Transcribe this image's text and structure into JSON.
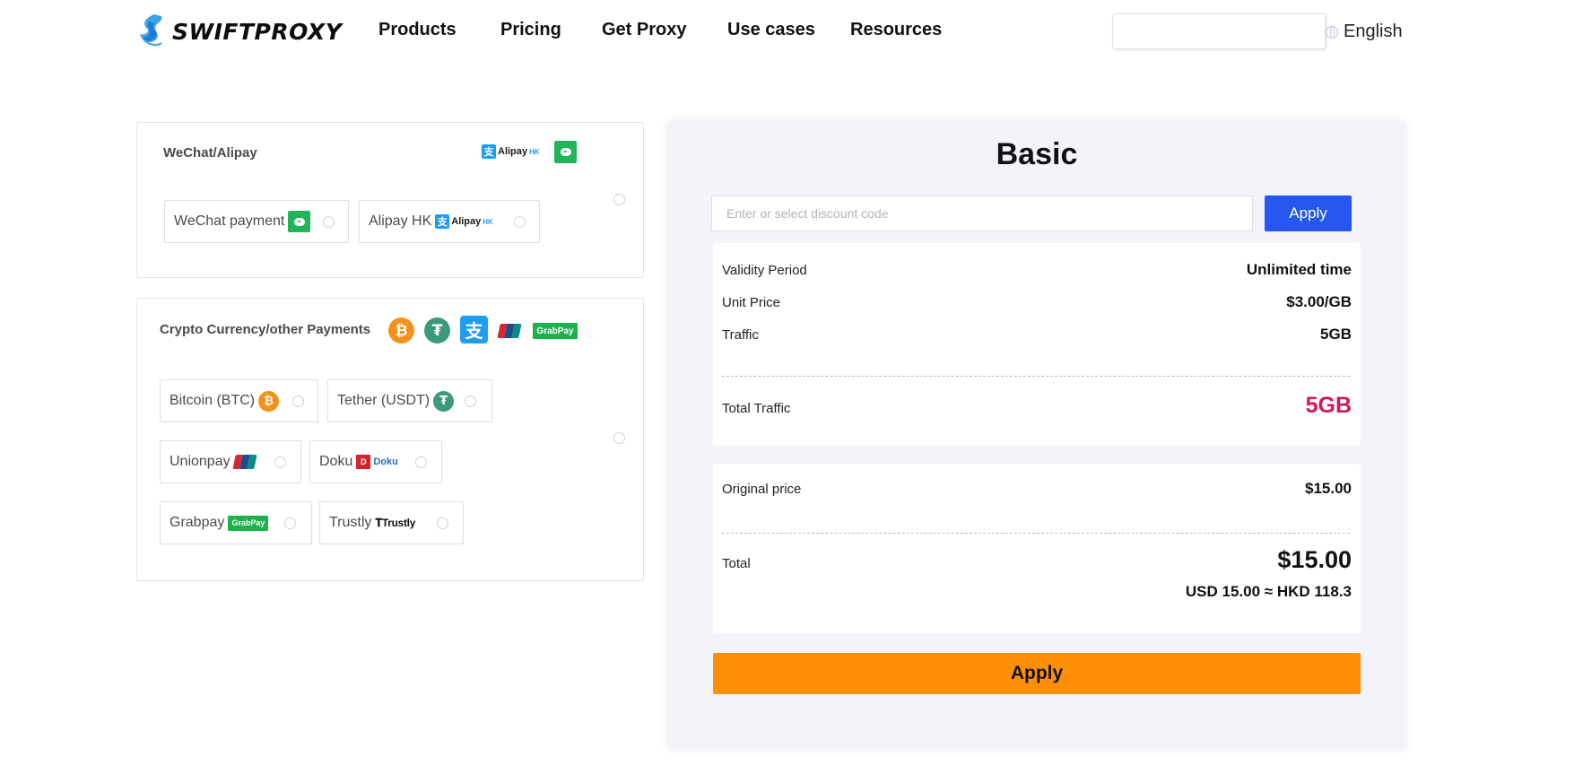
{
  "header": {
    "logo_text": "SWIFTPROXY",
    "nav": [
      "Products",
      "Pricing",
      "Get Proxy",
      "Use cases",
      "Resources"
    ],
    "language": "English",
    "search_value": ""
  },
  "payments": {
    "wechat_alipay": {
      "title": "WeChat/Alipay",
      "options": [
        {
          "label": "WeChat payment",
          "icon": "wechat-icon"
        },
        {
          "label": "Alipay HK",
          "icon": "alipay-hk-icon"
        }
      ]
    },
    "crypto": {
      "title": "Crypto Currency/other Payments",
      "options": [
        {
          "label": "Bitcoin (BTC)",
          "icon": "bitcoin-icon"
        },
        {
          "label": "Tether (USDT)",
          "icon": "tether-icon"
        },
        {
          "label": "Unionpay",
          "icon": "unionpay-icon"
        },
        {
          "label": "Doku",
          "icon": "doku-icon"
        },
        {
          "label": "Grabpay",
          "icon": "grabpay-icon"
        },
        {
          "label": "Trustly",
          "icon": "trustly-icon"
        }
      ]
    },
    "logo_texts": {
      "alipay": "Alipay",
      "hk": "HK",
      "alipay_char": "支",
      "bitcoin_symbol": "₿",
      "tether_symbol": "₮",
      "grabpay": "GrabPay",
      "doku": "Doku",
      "trustly": "Trustly"
    }
  },
  "order": {
    "plan": "Basic",
    "discount": {
      "placeholder": "Enter or select discount code",
      "value": "",
      "apply_label": "Apply"
    },
    "details": [
      {
        "label": "Validity Period",
        "value": "Unlimited time"
      },
      {
        "label": "Unit Price",
        "value": "$3.00/GB"
      },
      {
        "label": "Traffic",
        "value": "5GB"
      }
    ],
    "total_traffic": {
      "label": "Total Traffic",
      "value": "5GB"
    },
    "original_price": {
      "label": "Original price",
      "value": "$15.00"
    },
    "total": {
      "label": "Total",
      "value": "$15.00",
      "conversion": "USD 15.00 ≈ HKD 118.3"
    },
    "apply_label": "Apply"
  },
  "colors": {
    "accent_blue": "#2357f0",
    "accent_orange": "#ff8f07",
    "traffic_highlight": "#d0185d",
    "panel_bg": "#f3f4f9"
  }
}
